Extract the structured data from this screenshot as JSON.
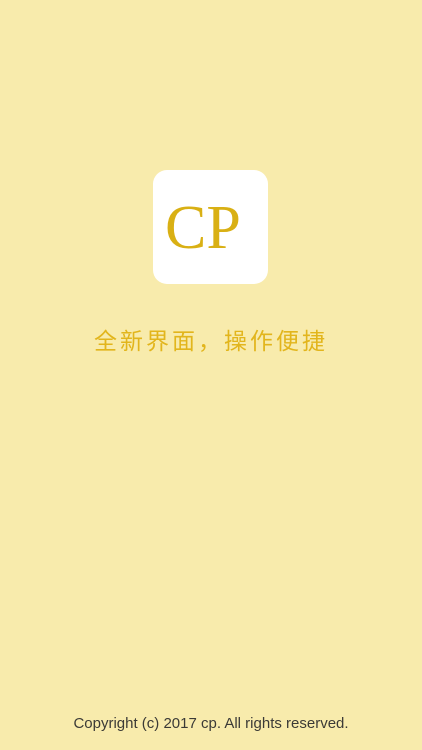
{
  "colors": {
    "background": "#f8ebac",
    "logo_tile": "#ffffff",
    "brand_gold": "#d9b014",
    "tagline": "#e2b51c",
    "footer_text": "#3b3a36"
  },
  "logo": {
    "letters": "CP",
    "icon": "cp-monogram-icon"
  },
  "tagline": "全新界面，操作便捷",
  "footer": {
    "copyright": "Copyright (c) 2017 cp. All rights reserved."
  }
}
